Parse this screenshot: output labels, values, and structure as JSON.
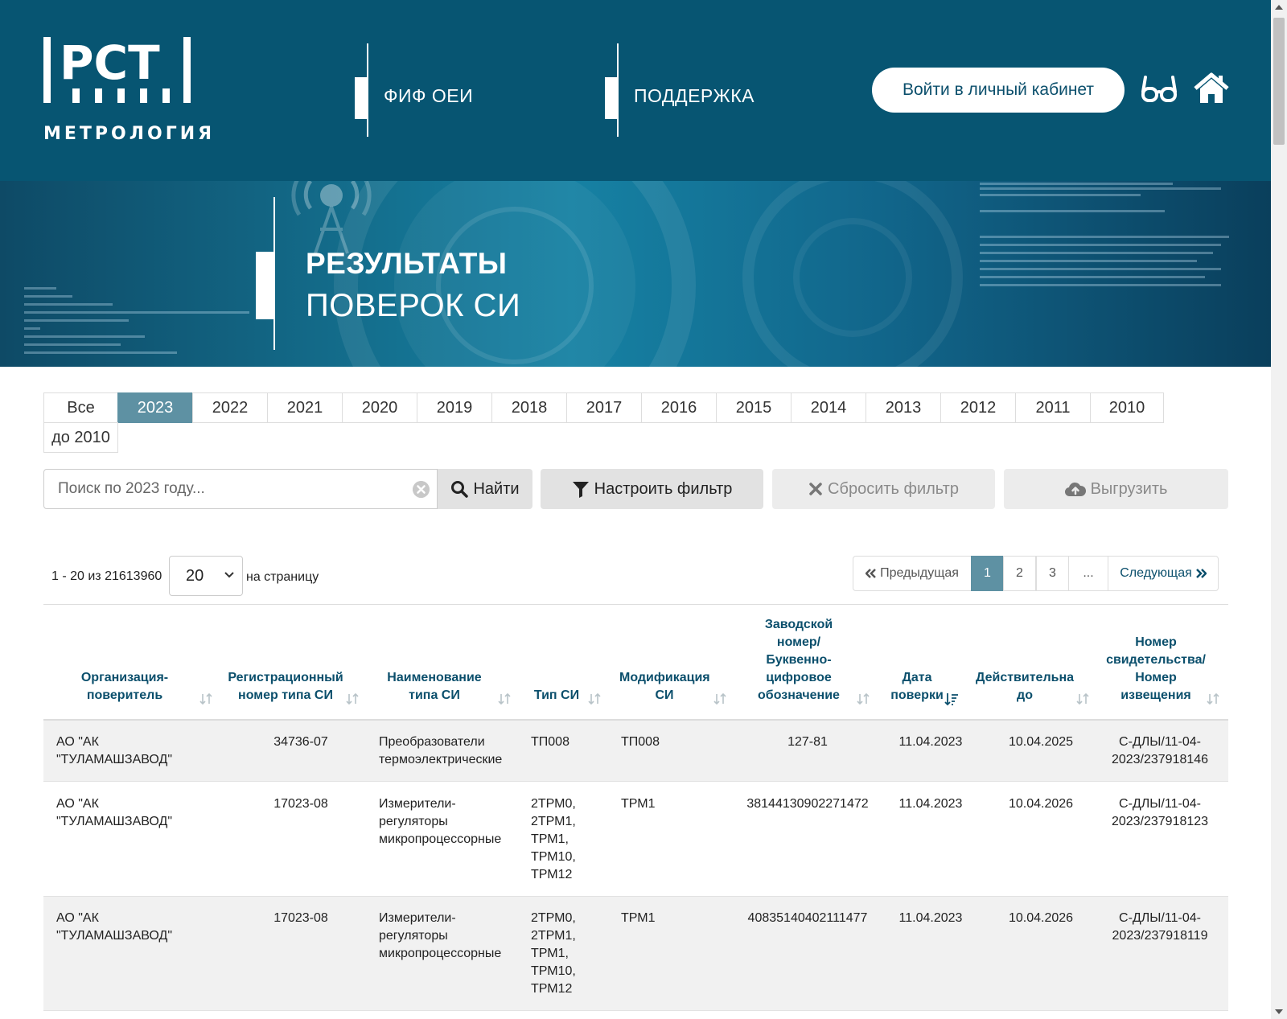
{
  "header": {
    "logo_text": "РСТ",
    "logo_subtitle": "МЕТРОЛОГИЯ",
    "nav": [
      {
        "label": "ФИФ ОЕИ"
      },
      {
        "label": "ПОДДЕРЖКА"
      }
    ],
    "login_label": "Войти в личный кабинет",
    "icons": [
      "glasses-icon",
      "home-icon"
    ]
  },
  "banner": {
    "title_line1": "РЕЗУЛЬТАТЫ",
    "title_line2": "ПОВЕРОК СИ"
  },
  "year_tabs": [
    "Все",
    "2023",
    "2022",
    "2021",
    "2020",
    "2019",
    "2018",
    "2017",
    "2016",
    "2015",
    "2014",
    "2013",
    "2012",
    "2011",
    "2010",
    "до 2010"
  ],
  "active_year": "2023",
  "search": {
    "placeholder": "Поиск по 2023 году...",
    "value": "",
    "find_label": "Найти",
    "filter_label": "Настроить фильтр",
    "reset_label": "Сбросить фильтр",
    "export_label": "Выгрузить"
  },
  "pagination": {
    "range_text": "1 - 20 из 21613960",
    "per_page": "20",
    "per_page_label": "на страницу",
    "prev_label": "Предыдущая",
    "pages": [
      "1",
      "2",
      "3",
      "..."
    ],
    "active_page": "1",
    "next_label": "Следующая"
  },
  "table": {
    "columns": [
      "Организация-поверитель",
      "Регистрационный номер типа СИ",
      "Наименование типа СИ",
      "Тип СИ",
      "Модификация СИ",
      "Заводской номер/ Буквенно-цифровое обозначение",
      "Дата поверки",
      "Действительна до",
      "Номер свидетельства/ Номер извещения"
    ],
    "rows": [
      {
        "org": "АО \"АК \"ТУЛАМАШЗАВОД\"",
        "reg_number": "34736-07",
        "type_name": "Преобразователи термоэлектрические",
        "type": "ТП008",
        "modification": "ТП008",
        "serial": "127-81",
        "date": "11.04.2023",
        "valid_to": "10.04.2025",
        "certificate": "С-ДЛЫ/11-04-2023/237918146"
      },
      {
        "org": "АО \"АК \"ТУЛАМАШЗАВОД\"",
        "reg_number": "17023-08",
        "type_name": "Измерители-регуляторы микропроцессорные",
        "type": "2ТРМ0, 2ТРМ1, ТРМ1, ТРМ10, ТРМ12",
        "modification": "ТРМ1",
        "serial": "38144130902271472",
        "date": "11.04.2023",
        "valid_to": "10.04.2026",
        "certificate": "С-ДЛЫ/11-04-2023/237918123"
      },
      {
        "org": "АО \"АК \"ТУЛАМАШЗАВОД\"",
        "reg_number": "17023-08",
        "type_name": "Измерители-регуляторы микропроцессорные",
        "type": "2ТРМ0, 2ТРМ1, ТРМ1, ТРМ10, ТРМ12",
        "modification": "ТРМ1",
        "serial": "40835140402111477",
        "date": "11.04.2023",
        "valid_to": "10.04.2026",
        "certificate": "С-ДЛЫ/11-04-2023/237918119"
      }
    ]
  },
  "colors": {
    "header_bg": "#075572",
    "accent": "#5e91a3",
    "heading_text": "#0b4f6c"
  }
}
